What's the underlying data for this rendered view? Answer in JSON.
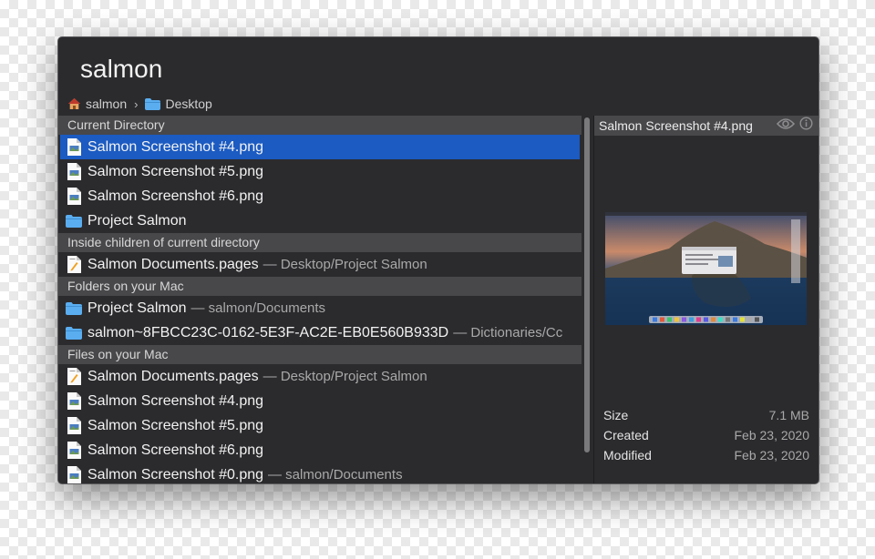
{
  "search": {
    "query": "salmon"
  },
  "breadcrumb": [
    {
      "label": "salmon",
      "icon": "home-icon"
    },
    {
      "label": "Desktop",
      "icon": "folder-icon"
    }
  ],
  "breadcrumb_separator": "›",
  "sections": {
    "current": "Current Directory",
    "children": "Inside children of current directory",
    "folders": "Folders on your Mac",
    "files": "Files on your Mac"
  },
  "current_items": [
    {
      "name": "Salmon Screenshot #4.png",
      "icon": "png-file-icon"
    },
    {
      "name": "Salmon Screenshot #5.png",
      "icon": "png-file-icon"
    },
    {
      "name": "Salmon Screenshot #6.png",
      "icon": "png-file-icon"
    },
    {
      "name": "Project Salmon",
      "icon": "folder-icon"
    }
  ],
  "children_items": [
    {
      "name": "Salmon Documents.pages",
      "path": "— Desktop/Project Salmon",
      "icon": "pages-file-icon"
    }
  ],
  "folder_items": [
    {
      "name": "Project Salmon",
      "path": "— salmon/Documents",
      "icon": "folder-icon"
    },
    {
      "name": "salmon~8FBCC23C-0162-5E3F-AC2E-EB0E560B933D",
      "path": "— Dictionaries/Cc",
      "icon": "folder-icon"
    }
  ],
  "file_items": [
    {
      "name": "Salmon Documents.pages",
      "path": "— Desktop/Project Salmon",
      "icon": "pages-file-icon"
    },
    {
      "name": "Salmon Screenshot #4.png",
      "icon": "png-file-icon"
    },
    {
      "name": "Salmon Screenshot #5.png",
      "icon": "png-file-icon"
    },
    {
      "name": "Salmon Screenshot #6.png",
      "icon": "png-file-icon"
    },
    {
      "name": "Salmon Screenshot #0.png",
      "path": "— salmon/Documents",
      "icon": "png-file-icon"
    }
  ],
  "preview": {
    "title": "Salmon Screenshot #4.png",
    "icons": [
      "eye-icon",
      "info-icon"
    ],
    "size_label": "Size",
    "size": "7.1 MB",
    "created_label": "Created",
    "created": "Feb 23, 2020",
    "modified_label": "Modified",
    "modified": "Feb 23, 2020"
  },
  "colors": {
    "selection": "#1b5bc2",
    "window": "#2b2b2e",
    "section": "#48484b",
    "folder": "#5aaef0"
  }
}
